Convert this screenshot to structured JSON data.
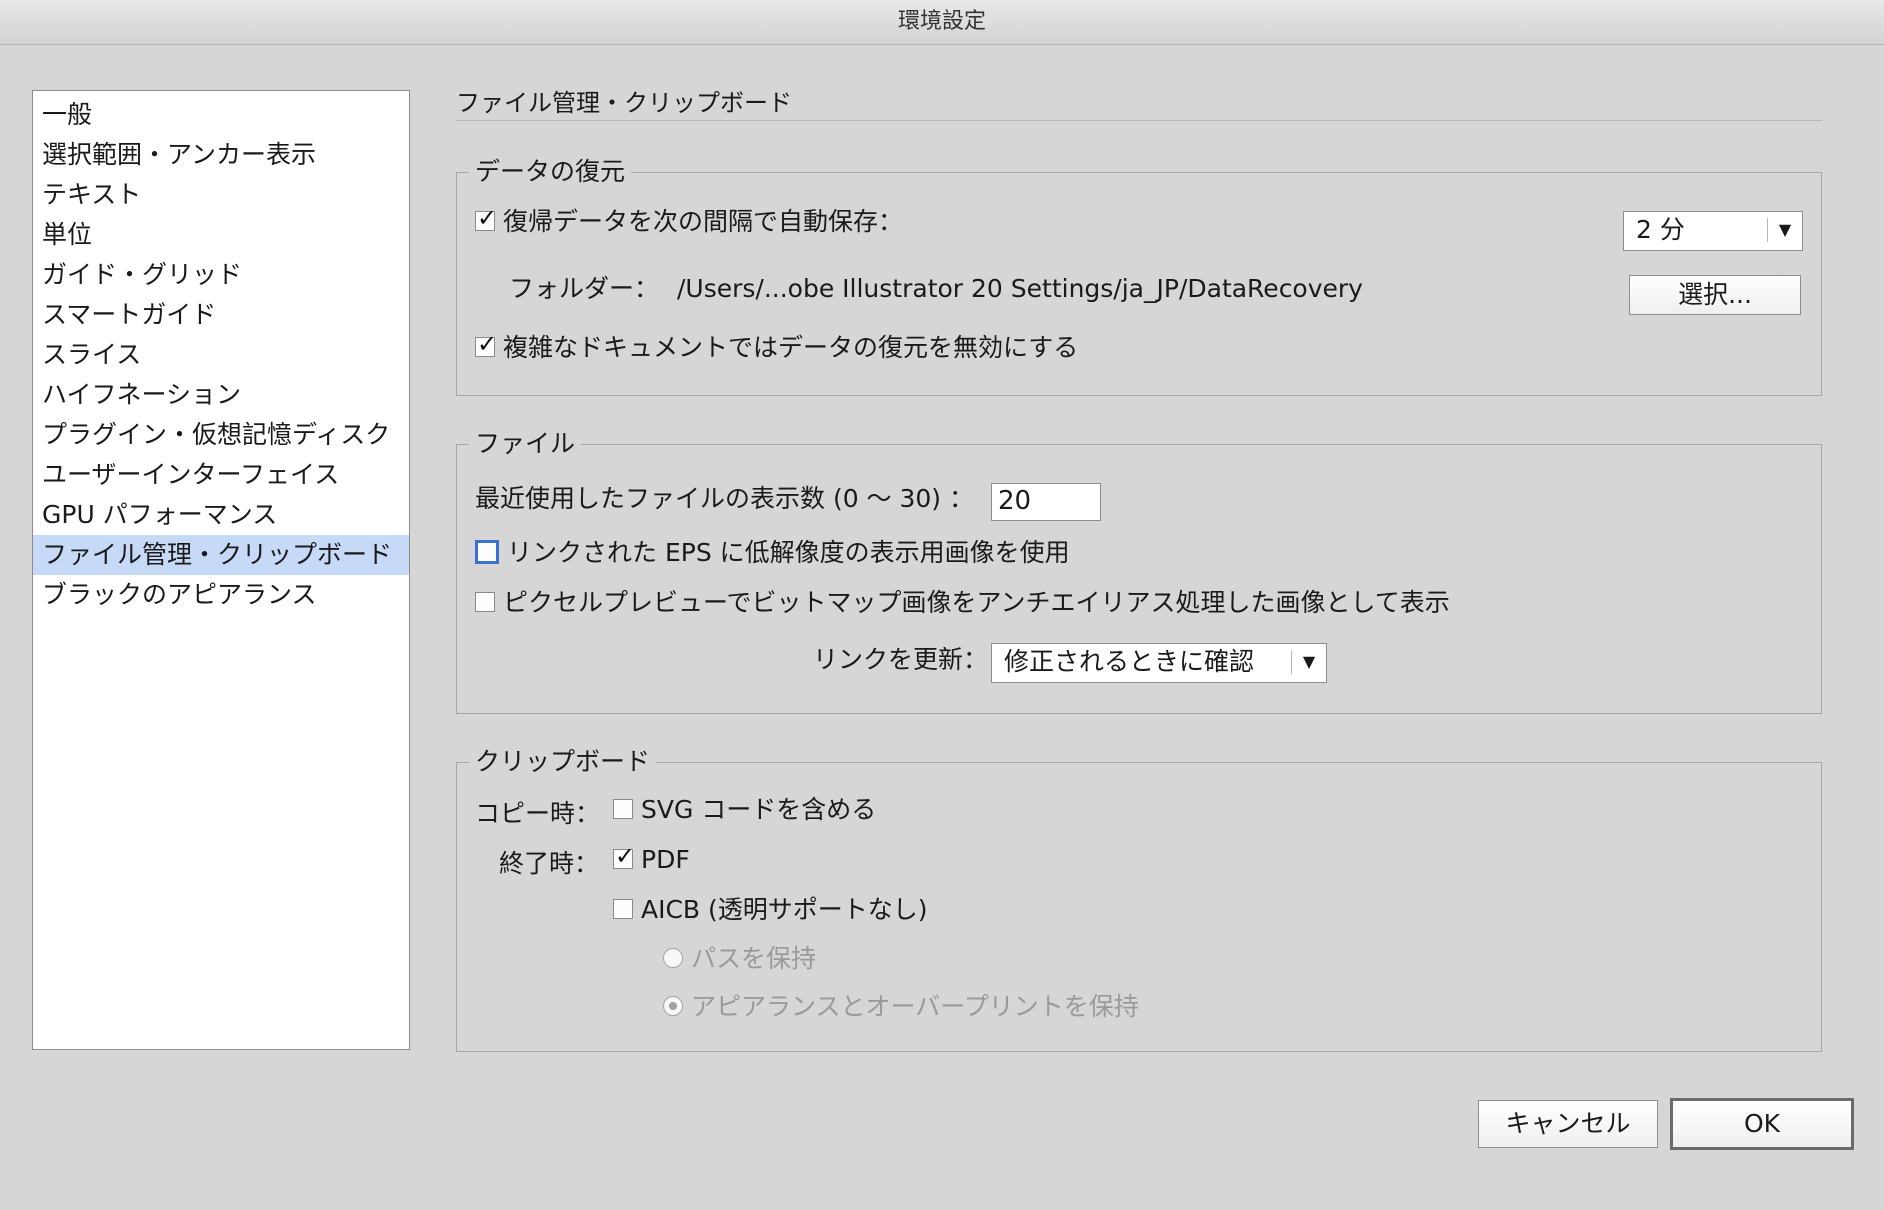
{
  "window": {
    "title": "環境設定"
  },
  "sidebar": {
    "items": [
      {
        "label": "一般"
      },
      {
        "label": "選択範囲・アンカー表示"
      },
      {
        "label": "テキスト"
      },
      {
        "label": "単位"
      },
      {
        "label": "ガイド・グリッド"
      },
      {
        "label": "スマートガイド"
      },
      {
        "label": "スライス"
      },
      {
        "label": "ハイフネーション"
      },
      {
        "label": "プラグイン・仮想記憶ディスク"
      },
      {
        "label": "ユーザーインターフェイス"
      },
      {
        "label": "GPU パフォーマンス"
      },
      {
        "label": "ファイル管理・クリップボード",
        "selected": true
      },
      {
        "label": "ブラックのアピアランス"
      }
    ]
  },
  "main": {
    "title": "ファイル管理・クリップボード"
  },
  "recovery": {
    "legend": "データの復元",
    "autosave_label": "復帰データを次の間隔で自動保存：",
    "autosave_checked": true,
    "interval_value": "2 分",
    "folder_label": "フォルダー：",
    "folder_path": "/Users/...obe Illustrator 20 Settings/ja_JP/DataRecovery",
    "choose_button": "選択...",
    "disable_complex_label": "複雑なドキュメントではデータの復元を無効にする",
    "disable_complex_checked": true
  },
  "files": {
    "legend": "ファイル",
    "recent_label": "最近使用したファイルの表示数 (0 〜 30) ：",
    "recent_value": "20",
    "low_res_eps_label": "リンクされた EPS に低解像度の表示用画像を使用",
    "low_res_eps_checked": false,
    "antialias_label": "ピクセルプレビューでビットマップ画像をアンチエイリアス処理した画像として表示",
    "antialias_checked": false,
    "update_links_label": "リンクを更新：",
    "update_links_value": "修正されるときに確認"
  },
  "clipboard": {
    "legend": "クリップボード",
    "copy_label": "コピー時：",
    "svg_label": "SVG コードを含める",
    "svg_checked": false,
    "quit_label": "終了時：",
    "pdf_label": "PDF",
    "pdf_checked": true,
    "aicb_label": "AICB (透明サポートなし)",
    "aicb_checked": false,
    "preserve_paths_label": "パスを保持",
    "preserve_appearance_label": "アピアランスとオーバープリントを保持",
    "selected_radio": "preserve_appearance"
  },
  "buttons": {
    "cancel": "キャンセル",
    "ok": "OK"
  }
}
